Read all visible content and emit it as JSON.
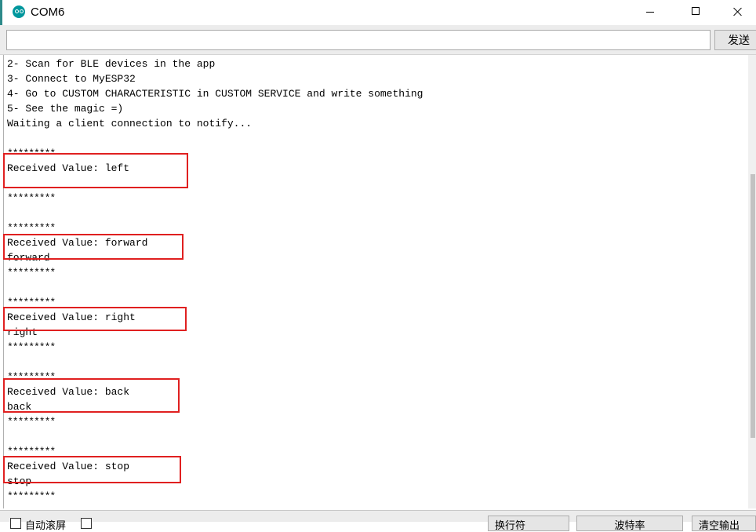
{
  "window": {
    "title": "COM6"
  },
  "send": {
    "input_value": "",
    "button_label": "发送"
  },
  "output": {
    "lines": [
      "2- Scan for BLE devices in the app",
      "3- Connect to MyESP32",
      "4- Go to CUSTOM CHARACTERISTIC in CUSTOM SERVICE and write something",
      "5- See the magic =)",
      "Waiting a client connection to notify...",
      "*********",
      "Received Value: left",
      "*********",
      "*********",
      "Received Value: forward",
      "forward",
      "*********",
      "*********",
      "Received Value: right",
      "right",
      "*********",
      "*********",
      "Received Value: back",
      "back",
      "*********",
      "*********",
      "Received Value: stop",
      "stop",
      "*********"
    ]
  },
  "bottom": {
    "autoscroll_label": "自动滚屏",
    "line_ending": "换行符",
    "baud": "波特率",
    "clear": "清空输出"
  },
  "colors": {
    "highlight": "#e02020",
    "arduino": "#00979d"
  }
}
